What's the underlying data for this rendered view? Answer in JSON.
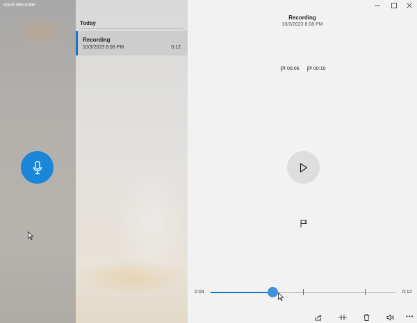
{
  "window": {
    "title": "Voice Recorder"
  },
  "list": {
    "section": "Today",
    "items": [
      {
        "name": "Recording",
        "date": "10/3/2023 8:08 PM",
        "duration": "0:12"
      }
    ]
  },
  "player": {
    "title": "Recording",
    "date": "10/3/2023 8:08 PM",
    "markers": [
      "00:06",
      "00:10"
    ],
    "current_time": "0:04",
    "total_time": "0:12",
    "progress_fraction": 0.333,
    "marker_fractions": [
      0.5,
      0.833
    ]
  },
  "icons": {
    "record": "microphone-icon",
    "play": "play-icon",
    "add_marker": "flag-icon",
    "share": "share-icon",
    "trim": "trim-icon",
    "delete": "trash-icon",
    "speaker": "speaker-icon",
    "more": "more-icon"
  },
  "colors": {
    "accent": "#1a73c8",
    "record_button": "#1a86d9"
  }
}
